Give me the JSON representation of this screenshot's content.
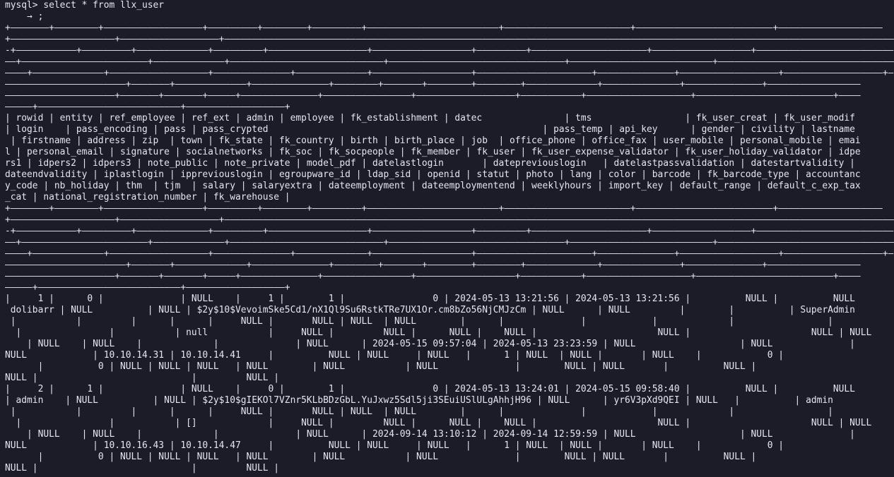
{
  "terminal": {
    "title": "mysql",
    "lines": [
      "mysql> select * from llx_user",
      "    → ;",
      "+———————+————————+——————————————————+—————————+————————+—————————+————————————————————————+———————————————————————+—————————————————————————+———————————————————",
      "+———————————————————+——————————————————+——————————————————————————————————————————————————————————————————————————————————————————————————————————————————————————————————",
      "-+———————————+—————————+—————————————+—————————+——————————————————+——————————————————+—————————+—————————————————————+——————————————————+—————————————————————————",
      "——+———————————————————————+—————————————+————————————————————————————+————————————————————————————————+——————————————————————————+——————————————————————————————————————",
      "————+—————————————+——————————————————+——————————————+—————————————+——————————————————+—————————————————————+——————————————+——————————————————+——————————————————+—",
      "——————————————————————+———————+—————————————+——————————————+————————+———————+————————+————————+—————————————+——————————————+——————————————+—————————————————",
      "————————————————————+———————+———————+—————+——————————————+————————————————+——————————————————+———————————+———————————————————+—————————————————————————+————",
      "—————+——————————————————————————+——————————————————+",
      "| rowid | entity | ref_employee | ref_ext | admin | employee | fk_establishment | datec               | tms                 | fk_user_creat | fk_user_modif",
      "| login    | pass_encoding | pass | pass_crypted                                                  | pass_temp | api_key      | gender | civility | lastname",
      " | firstname | address | zip  | town | fk_state | fk_country | birth | birth_place | job  | office_phone | office_fax | user_mobile | personal_mobile | emai",
      "l | personal_email | signature | socialnetworks | fk_soc | fk_socpeople | fk_member | fk_user | fk_user_expense_validator | fk_user_holiday_validator | idpe",
      "rs1 | idpers2 | idpers3 | note_public | note_private | model_pdf | datelastlogin       | datepreviouslogin   | datelastpassvalidation | datestartvalidity |",
      "dateendvalidity | iplastlogin | ippreviouslogin | egroupware_id | ldap_sid | openid | statut | photo | lang | color | barcode | fk_barcode_type | accountanc",
      "y_code | nb_holiday | thm  | tjm  | salary | salaryextra | dateemployment | dateemploymentend | weeklyhours | import_key | default_range | default_c_exp_tax",
      "_cat | national_registration_number | fk_warehouse |",
      "+———————+————————+——————————————————+—————————+————————+—————————+————————————————————————+———————————————————————+—————————————————————————+———————————————————",
      "+———————————————————+——————————————————+——————————————————————————————————————————————————————————————————————————————————————————————————————————————————————————————————",
      "-+———————————+—————————+—————————————+—————————+——————————————————+——————————————————+—————————+—————————————————————+——————————————————+—————————————————————————",
      "——+———————————————————————+—————————————+————————————————————————————+————————————————————————————————+——————————————————————————+——————————————————————————————————————",
      "————+—————————————+——————————————————+——————————————+—————————————+——————————————————+—————————————————————+——————————————+——————————————————+——————————————————+—",
      "——————————————————————+———————+—————————————+——————————————+————————+———————+————————+————————+—————————————+——————————————+——————————————+—————————————————",
      "————————————————————+———————+———————+—————+——————————————+————————————————+——————————————————+———————————+———————————————————+—————————————————————————+————",
      "—————+——————————————————————————+——————————————————+",
      "|     1 |      0 |              | NULL    |     1 |        1 |                0 | 2024-05-13 13:21:56 | 2024-05-13 13:21:56 |          NULL |          NULL",
      " dolibarr | NULL          | NULL | $2y$10$VevoimSke5Cd1/nX1Ql9Su6RstkTRe7UX1Or.cm8bZo56NjCMJzCm | NULL      | NULL         |        |          | SuperAdmin",
      " |           |         |      |      |     NULL |       NULL | NULL  | NULL        |      |              |            |             |                 |",
      "  |                |           | null           |     NULL |         NULL |      NULL |    NULL |                      NULL |                      NULL | NULL",
      "    | NULL    | NULL    |             |              | NULL      | 2024-05-15 09:57:04 | 2024-05-13 23:23:59 | NULL                   | NULL              |",
      "NULL            | 10.10.14.31 | 10.10.14.41     |          NULL | NULL     | NULL   |      1 | NULL  | NULL |       | NULL    |            0 |",
      "      |          0 | NULL | NULL | NULL   | NULL        | NULL           | NULL              |        NULL | NULL       |          NULL |",
      "NULL |                            |         NULL |",
      "|     2 |      1 |              | NULL    |     0 |        1 |                0 | 2024-05-13 13:24:01 | 2024-05-15 09:58:40 |          NULL |          NULL",
      "| admin    | NULL          | NULL | $2y$10$gIEKOl7VZnr5KLbBDzGbL.YuJxwz5Sdl5ji3SEuiUSlULgAhhjH96 | NULL      | yr6V3pXd9QEI | NULL   |          | admin",
      " |           |         |      |      |     NULL |       NULL | NULL  | NULL        |      |              |            |             |                 |",
      "  |                |           | []             |     NULL |         NULL |      NULL |    NULL |                      NULL |                      NULL | NULL",
      "    | NULL    | NULL    |             |              | NULL      | 2024-09-14 13:10:12 | 2024-09-14 12:59:59 | NULL                   | NULL              |",
      "NULL            | 10.10.16.43 | 10.10.14.47     |          NULL | NULL     | NULL   |      1 | NULL  | NULL |       | NULL    |            0 |",
      "      |          0 | NULL | NULL | NULL   | NULL        | NULL           | NULL              |        NULL | NULL       |          NULL |",
      "NULL |                            |         NULL |"
    ]
  }
}
